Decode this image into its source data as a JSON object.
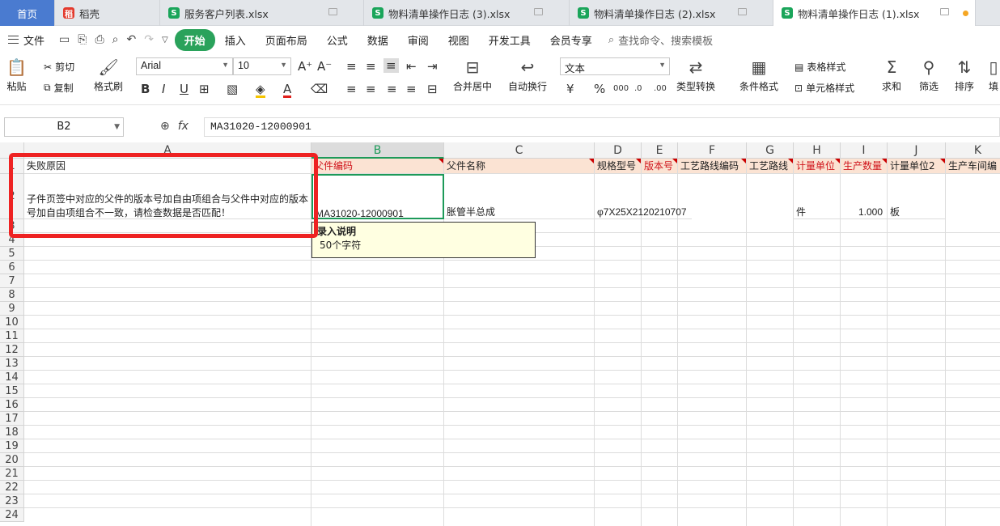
{
  "tabs": [
    {
      "label": "首页"
    },
    {
      "label": "稻壳"
    },
    {
      "label": "服务客户列表.xlsx"
    },
    {
      "label": "物料清单操作日志 (3).xlsx"
    },
    {
      "label": "物料清单操作日志 (2).xlsx"
    },
    {
      "label": "物料清单操作日志 (1).xlsx"
    }
  ],
  "menu": {
    "file": "文件",
    "items": [
      "开始",
      "插入",
      "页面布局",
      "公式",
      "数据",
      "审阅",
      "视图",
      "开发工具",
      "会员专享"
    ],
    "search": "查找命令、搜索模板"
  },
  "ribbon": {
    "paste": "粘贴",
    "cut": "剪切",
    "copy": "复制",
    "format_painter": "格式刷",
    "font_name": "Arial",
    "font_size": "10",
    "merge_center": "合并居中",
    "wrap_text": "自动换行",
    "number_format": "文本",
    "convert_type": "类型转换",
    "cond_format": "条件格式",
    "table_style": "表格样式",
    "cell_style": "单元格样式",
    "sum": "求和",
    "filter": "筛选",
    "sort": "排序",
    "fill": "填"
  },
  "formula_bar": {
    "name_box": "B2",
    "value": "MA31020-12000901"
  },
  "columns": [
    "A",
    "B",
    "C",
    "D",
    "E",
    "F",
    "G",
    "H",
    "I",
    "J",
    "K"
  ],
  "header_row": [
    "失败原因",
    "父件编码",
    "父件名称",
    "规格型号",
    "版本号",
    "工艺路线编码",
    "工艺路线",
    "计量单位",
    "生产数量",
    "计量单位2",
    "生产车间编"
  ],
  "data_row": {
    "A": "子件页签中对应的父件的版本号加自由项组合与父件中对应的版本号加自由项组合不一致，请检查数据是否匹配！",
    "B": "MA31020-12000901",
    "C": "胀管半总成",
    "D": "φ7X25X2120210707",
    "H": "件",
    "I": "1.000",
    "J": "板"
  },
  "row_numbers": [
    "1",
    "2",
    "3",
    "4",
    "5",
    "6",
    "7",
    "8",
    "9",
    "10",
    "11",
    "12",
    "13",
    "14",
    "15",
    "16",
    "17",
    "18",
    "19",
    "20",
    "21",
    "22",
    "23",
    "24"
  ],
  "tooltip": {
    "title": "录入说明",
    "body": "50个字符"
  }
}
